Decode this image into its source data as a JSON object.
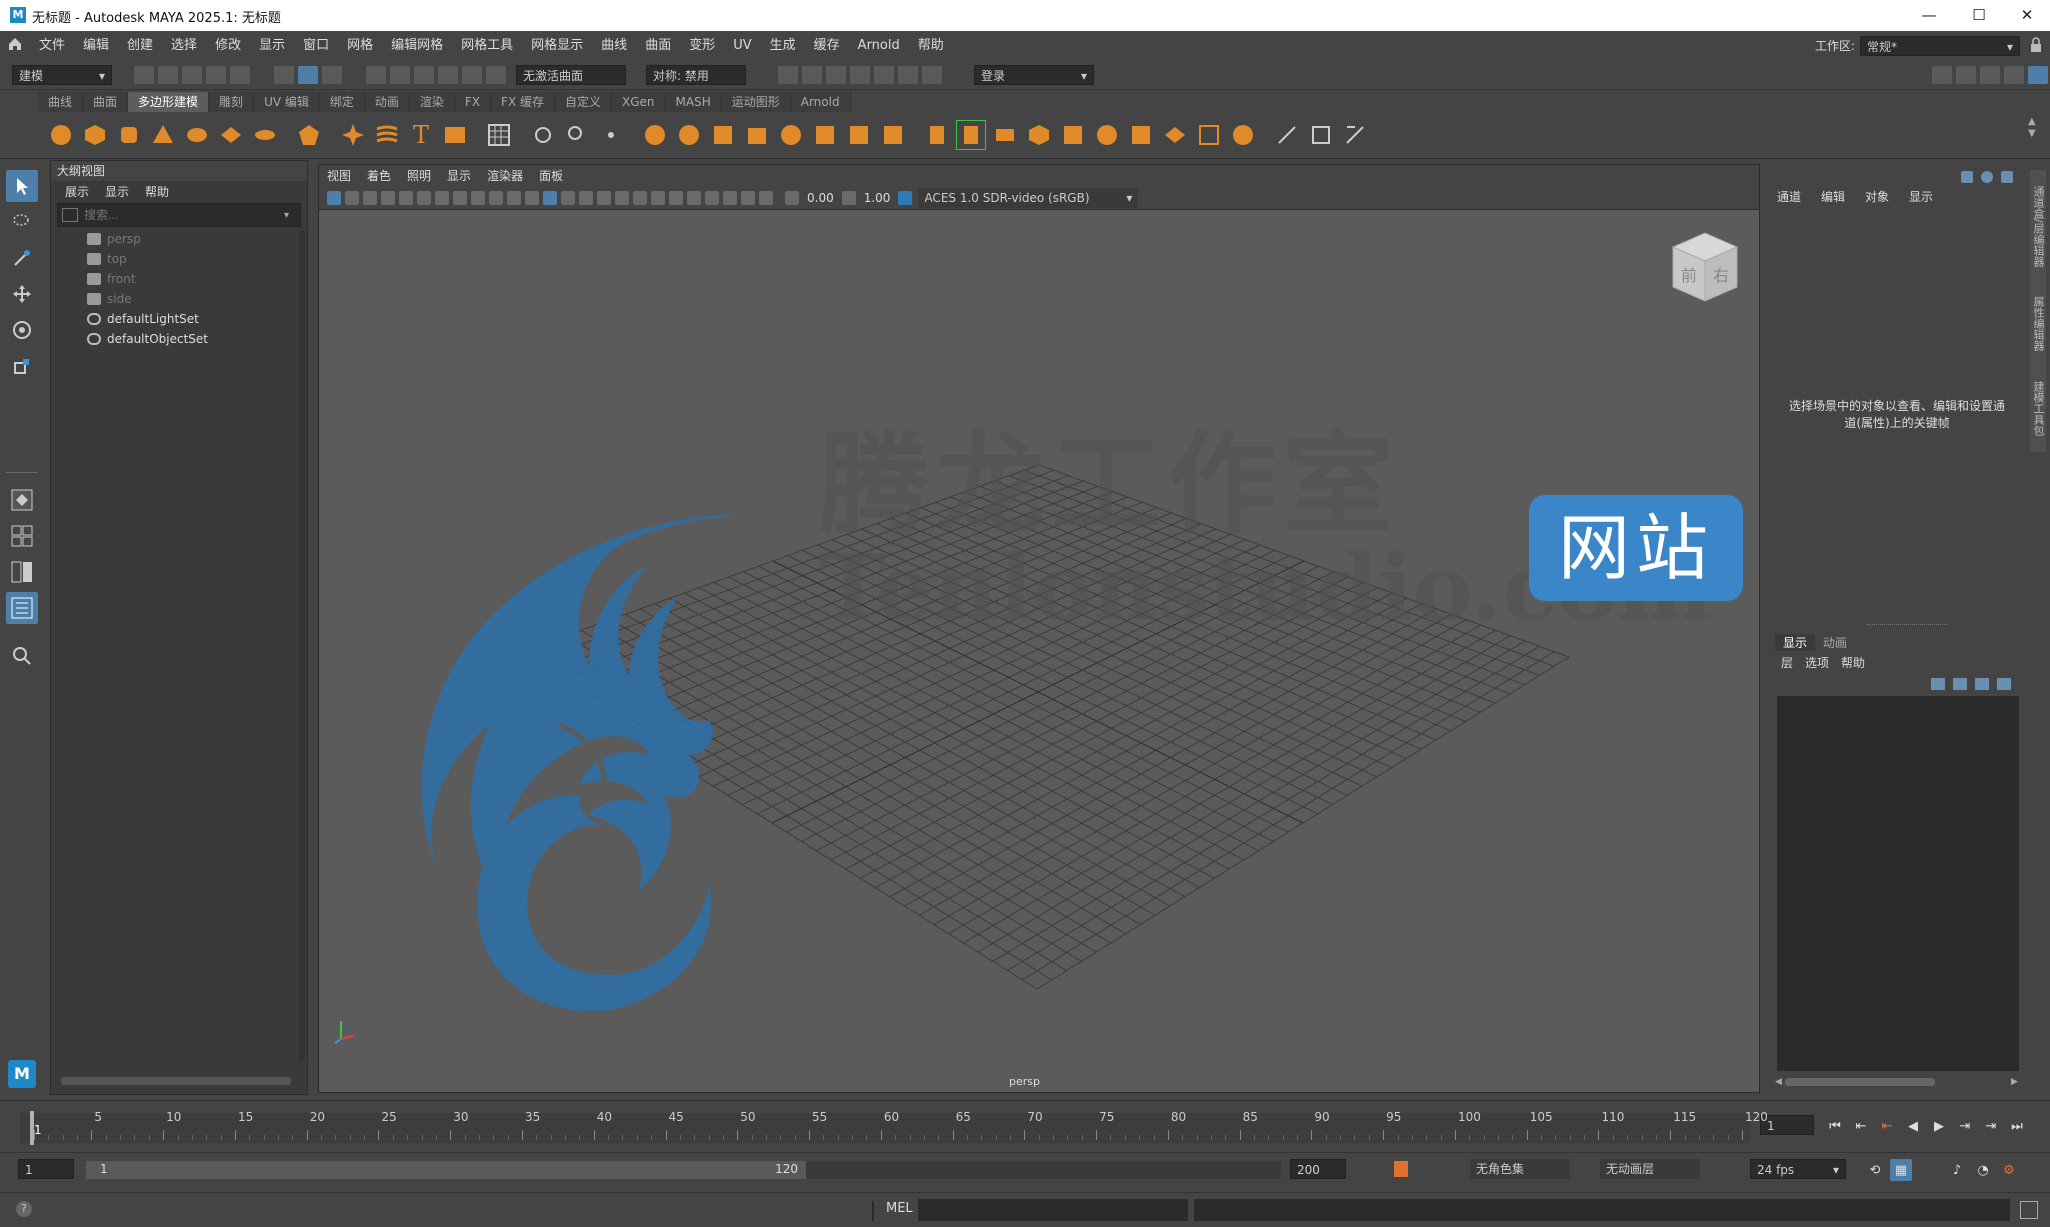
{
  "window": {
    "title": "无标题 - Autodesk MAYA 2025.1: 无标题",
    "app_icon_letter": "M",
    "minimize_label": "—",
    "maximize_label": "☐",
    "close_label": "✕"
  },
  "menubar": {
    "items": [
      "文件",
      "编辑",
      "创建",
      "选择",
      "修改",
      "显示",
      "窗口",
      "网格",
      "编辑网格",
      "网格工具",
      "网格显示",
      "曲线",
      "曲面",
      "变形",
      "UV",
      "生成",
      "缓存",
      "Arnold",
      "帮助"
    ],
    "workspace_label": "工作区:",
    "workspace_value": "常规*"
  },
  "statusline": {
    "mode_dropdown": "建模",
    "live_surface": "无激活曲面",
    "symmetry": "对称: 禁用",
    "login": "登录"
  },
  "shelf": {
    "tabs": [
      "曲线",
      "曲面",
      "多边形建模",
      "雕刻",
      "UV 编辑",
      "绑定",
      "动画",
      "渲染",
      "FX",
      "FX 缓存",
      "自定义",
      "XGen",
      "MASH",
      "运动图形",
      "Arnold"
    ],
    "active_tab_index": 2
  },
  "outliner": {
    "title": "大纲视图",
    "menu": [
      "展示",
      "显示",
      "帮助"
    ],
    "search_placeholder": "搜索...",
    "items": [
      {
        "label": "persp",
        "type": "camera",
        "dim": true
      },
      {
        "label": "top",
        "type": "camera",
        "dim": true
      },
      {
        "label": "front",
        "type": "camera",
        "dim": true
      },
      {
        "label": "side",
        "type": "camera",
        "dim": true
      },
      {
        "label": "defaultLightSet",
        "type": "set",
        "dim": false
      },
      {
        "label": "defaultObjectSet",
        "type": "set",
        "dim": false
      }
    ]
  },
  "viewport": {
    "menu": [
      "视图",
      "着色",
      "照明",
      "显示",
      "渲染器",
      "面板"
    ],
    "exposure_value": "0.00",
    "gamma_value": "1.00",
    "color_space": "ACES 1.0 SDR-video (sRGB)",
    "camera_label": "persp",
    "viewcube_front": "前",
    "viewcube_right": "右",
    "watermark_cn": "腾龙工作室",
    "watermark_en": "Tenlonstudio.com",
    "badge_text": "网站"
  },
  "channelbox": {
    "menu": [
      "通道",
      "编辑",
      "对象",
      "显示"
    ],
    "hint": "选择场景中的对象以查看、编辑和设置通道(属性)上的关键帧"
  },
  "layereditor": {
    "tabs": [
      "显示",
      "动画"
    ],
    "menu": [
      "层",
      "选项",
      "帮助"
    ]
  },
  "sidetabs": [
    "通道盒/层编辑器",
    "属性编辑器",
    "建模工具包"
  ],
  "timeline": {
    "ticks": [
      "1",
      "5",
      "10",
      "15",
      "20",
      "25",
      "30",
      "35",
      "40",
      "45",
      "50",
      "55",
      "60",
      "65",
      "70",
      "75",
      "80",
      "85",
      "90",
      "95",
      "100",
      "105",
      "110",
      "115",
      "120"
    ],
    "current_frame": "1"
  },
  "range": {
    "start": "1",
    "playback_start": "1",
    "playback_end": "120",
    "end": "200",
    "character_set": "无角色集",
    "anim_layer": "无动画层",
    "fps": "24 fps"
  },
  "cmdline": {
    "label": "MEL",
    "help": "?"
  },
  "colors": {
    "shelf_icon": "#e08a2a",
    "accent_blue": "#3d8fd6",
    "badge_bg": "#3a86c8"
  }
}
